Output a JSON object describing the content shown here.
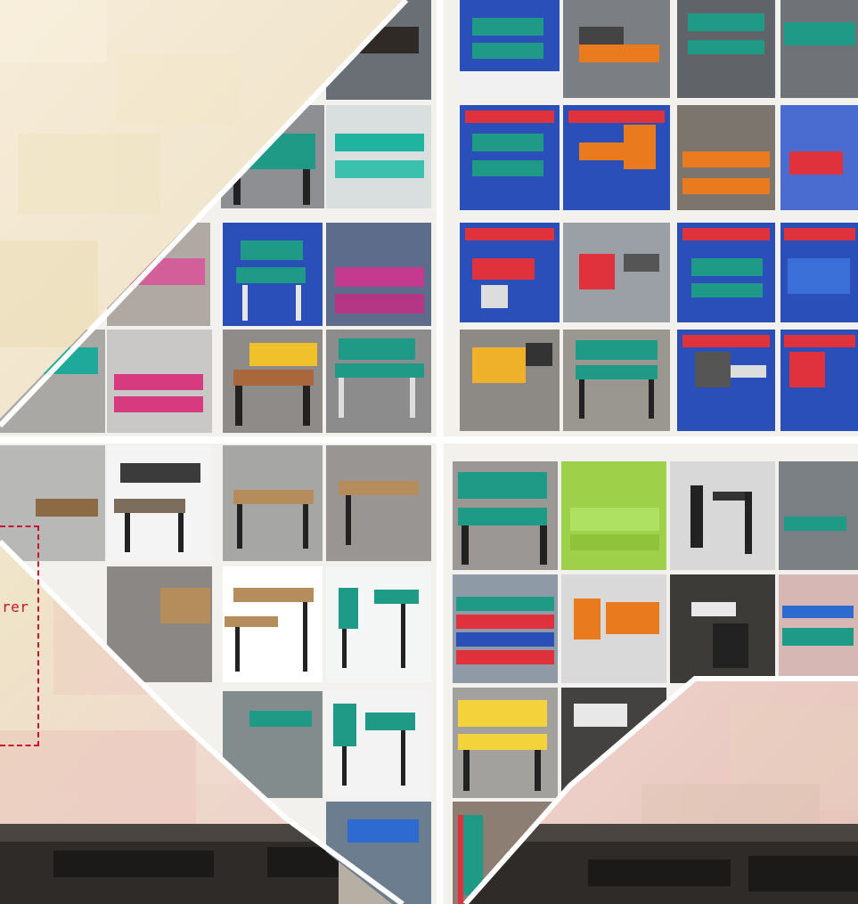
{
  "banner": {
    "fragment_text": "rer"
  },
  "colors": {
    "accent": "#c8102e",
    "panel_bg": "#f3f1ee",
    "photo_blue": "#2b4fb8",
    "bench_green": "#1f9a86",
    "bench_orange": "#ea7a1e",
    "bench_red": "#e0323c",
    "bench_yellow": "#f4d23c",
    "floor_grey": "#9a9a9a"
  },
  "gallery": {
    "section_top_left": {
      "columns": 2,
      "rows": 4,
      "icon": "school-bench-photo"
    },
    "section_top_right": {
      "columns": 4,
      "rows": 4,
      "icon": "school-bench-photo"
    },
    "section_bottom_left": {
      "columns": 2,
      "rows": 4,
      "icon": "school-bench-photo"
    },
    "section_bottom_right": {
      "columns": 4,
      "rows": 4,
      "icon": "school-bench-photo"
    }
  }
}
